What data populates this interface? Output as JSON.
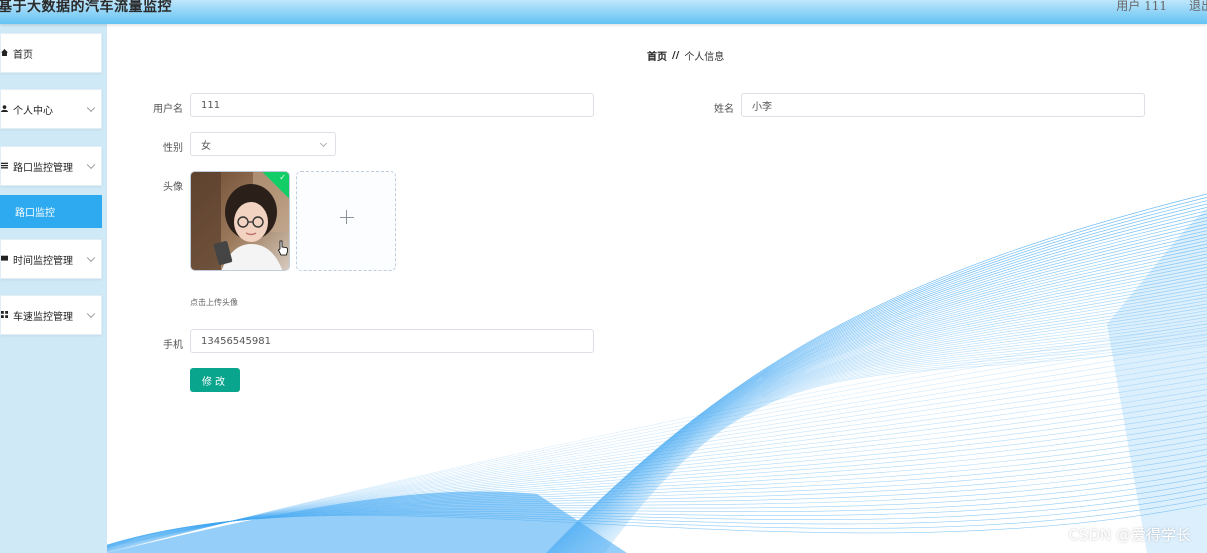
{
  "header": {
    "title": "基于大数据的汽车流量监控",
    "user_text": "用户 111",
    "logout_label": "退出"
  },
  "sidebar": {
    "items": [
      {
        "label": "首页",
        "icon": "home-icon"
      },
      {
        "label": "个人中心",
        "icon": "user-icon"
      },
      {
        "label": "路口监控管理",
        "icon": "list-icon"
      },
      {
        "label": "时间监控管理",
        "icon": "bookmark-icon"
      },
      {
        "label": "车速监控管理",
        "icon": "grid-icon"
      }
    ],
    "active_subitem": "路口监控"
  },
  "breadcrumb": {
    "home": "首页",
    "separator": "//",
    "current": "个人信息"
  },
  "form": {
    "username_label": "用户名",
    "username_value": "111",
    "name_label": "姓名",
    "name_value": "小李",
    "gender_label": "性别",
    "gender_value": "女",
    "avatar_label": "头像",
    "upload_hint": "点击上传头像",
    "phone_label": "手机",
    "phone_value": "13456545981",
    "submit_label": "修改"
  },
  "watermark": "CSDN @爱得学长",
  "colors": {
    "header_top": "#bfe6fb",
    "header_bottom": "#63c3f4",
    "sidebar_bg": "#cfe9f7",
    "active_item": "#2eaaf0",
    "submit_button": "#0aa58d",
    "wave": "#3ea6f2"
  }
}
